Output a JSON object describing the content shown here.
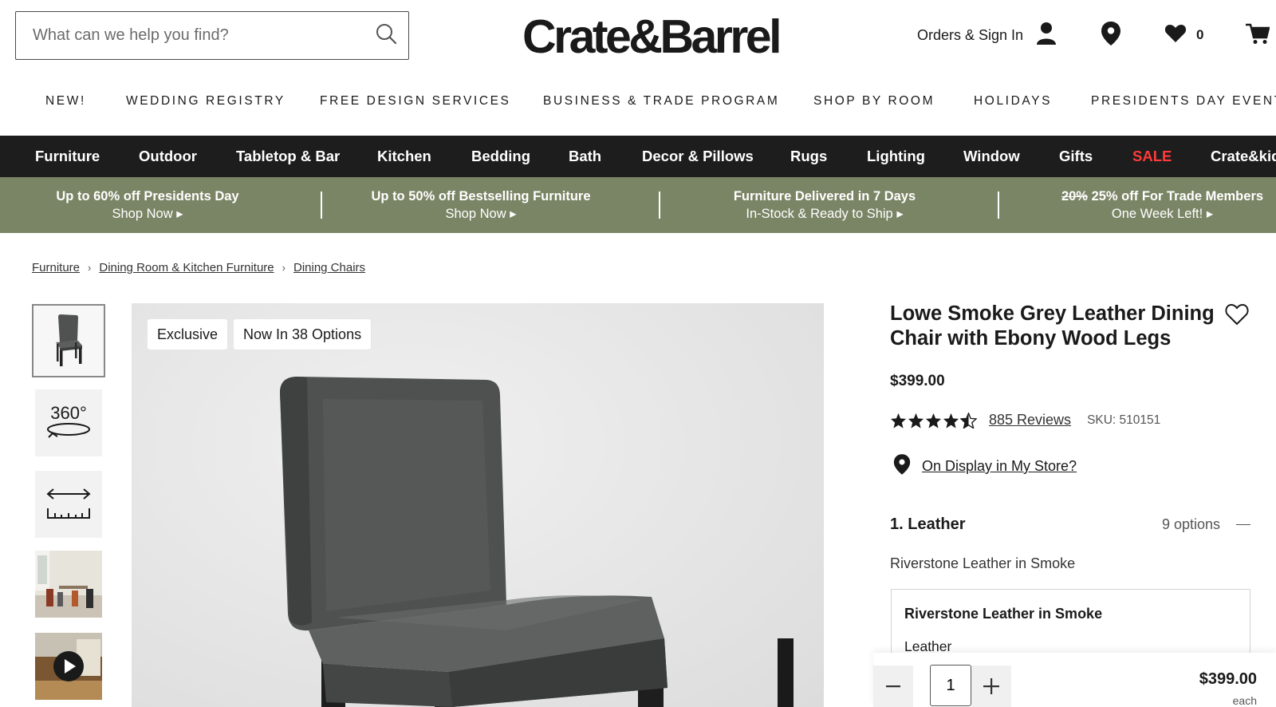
{
  "header": {
    "search_placeholder": "What can we help you find?",
    "logo_text": "Crate&Barrel",
    "orders_label": "Orders & Sign In",
    "favorites_count": "0"
  },
  "top_nav": [
    "NEW!",
    "WEDDING REGISTRY",
    "FREE DESIGN SERVICES",
    "BUSINESS & TRADE PROGRAM",
    "SHOP BY ROOM",
    "HOLIDAYS",
    "PRESIDENTS DAY EVENT"
  ],
  "category_nav": [
    "Furniture",
    "Outdoor",
    "Tabletop & Bar",
    "Kitchen",
    "Bedding",
    "Bath",
    "Decor & Pillows",
    "Rugs",
    "Lighting",
    "Window",
    "Gifts",
    "SALE",
    "Crate&kids"
  ],
  "promos": [
    {
      "line1": "Up to 60% off Presidents Day",
      "line2": "Shop Now ▸"
    },
    {
      "line1": "Up to 50% off Bestselling Furniture",
      "line2": "Shop Now ▸"
    },
    {
      "line1": "Furniture Delivered in 7 Days",
      "line2": "In-Stock & Ready to Ship ▸"
    },
    {
      "line1_strike": "20%",
      "line1": "25% off For Trade Members",
      "line2": "One Week Left! ▸"
    }
  ],
  "breadcrumb": [
    "Furniture",
    "Dining Room & Kitchen Furniture",
    "Dining Chairs"
  ],
  "thumbnails": {
    "view360_label": "360°"
  },
  "main_image": {
    "tags": [
      "Exclusive",
      "Now In 38 Options"
    ]
  },
  "product": {
    "title": "Lowe Smoke Grey Leather Dining Chair with Ebony Wood Legs",
    "price": "$399.00",
    "rating": 4.5,
    "reviews_label": "885 Reviews",
    "sku": "SKU: 510151",
    "store_link": "On Display in My Store?",
    "option_heading": "1. Leather",
    "option_count": "9 options",
    "selected_option": "Riverstone Leather in Smoke",
    "option_card_name": "Riverstone Leather in Smoke",
    "option_card_sub": "Leather"
  },
  "purchase": {
    "quantity": "1",
    "price": "$399.00",
    "unit": "each"
  },
  "colors": {
    "category_bar": "#1d1d1d",
    "promo_bar": "#7a8565",
    "sale": "#ff3b3b"
  }
}
